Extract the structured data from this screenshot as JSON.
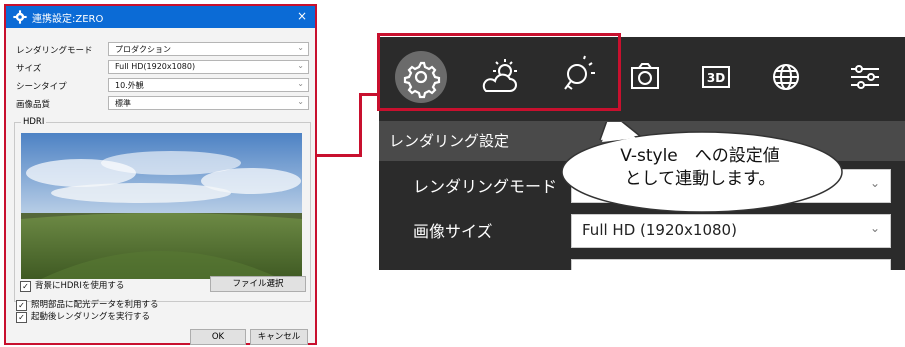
{
  "dialog": {
    "title": "連携設定:ZERO",
    "close_glyph": "×",
    "rows": [
      {
        "label": "レンダリングモード",
        "value": "プロダクション"
      },
      {
        "label": "サイズ",
        "value": "Full HD(1920x1080)"
      },
      {
        "label": "シーンタイプ",
        "value": "10.外観"
      },
      {
        "label": "画像品質",
        "value": "標準"
      }
    ],
    "hdri_group_label": "HDRI",
    "bg_hdri_checkbox": "背景にHDRIを使用する",
    "file_select_button": "ファイル選択",
    "light_checkbox": "照明部品に配光データを利用する",
    "render_checkbox": "起動後レンダリングを実行する",
    "ok_button": "OK",
    "cancel_button": "キャンセル"
  },
  "panel": {
    "toolbar_icons": [
      "gear-icon",
      "weather-icon",
      "light-bulb-icon",
      "camera-icon",
      "3d-icon",
      "globe-icon",
      "sliders-icon"
    ],
    "section_title": "レンダリング設定",
    "rows": [
      {
        "label": "レンダリングモード",
        "value": ""
      },
      {
        "label": "画像サイズ",
        "value": "Full HD (1920x1080)"
      }
    ]
  },
  "callout": {
    "line1": "V-style　への設定値",
    "line2": "として連動します。"
  },
  "colors": {
    "accent_red": "#c8102e",
    "titlebar_blue": "#0b6bd6",
    "panel_dark": "#2b2b2b"
  }
}
